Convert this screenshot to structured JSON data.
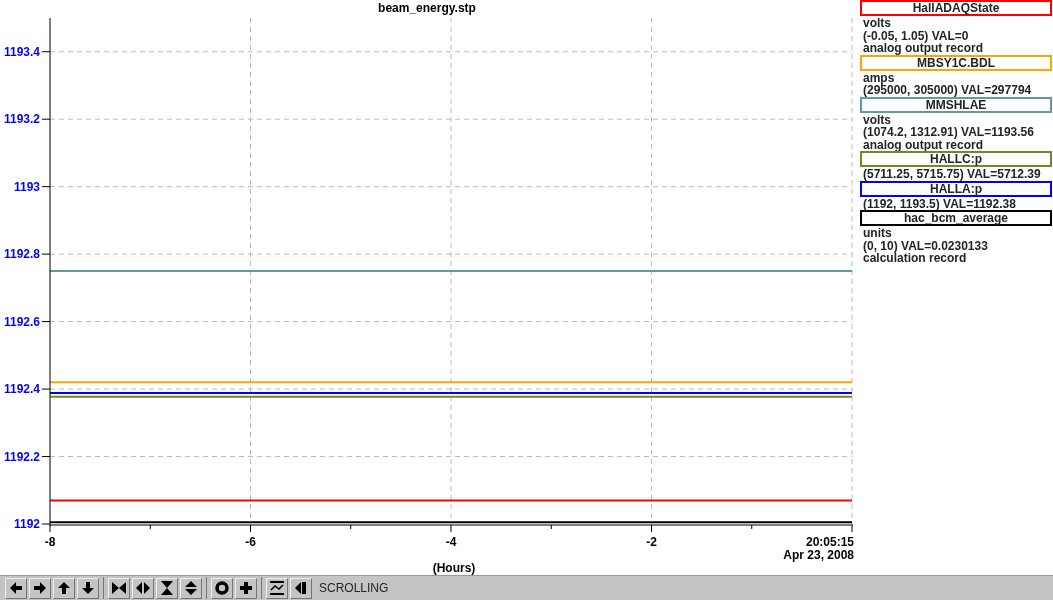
{
  "chart": {
    "chart_data": {
      "type": "line",
      "title": "beam_energy.stp",
      "xlabel": "(Hours)",
      "x": [
        -8,
        0
      ],
      "xlim": [
        -8,
        0
      ],
      "ylim": [
        1192,
        1193.5
      ],
      "xticks": [
        -8,
        -6,
        -4,
        -2
      ],
      "grid": true,
      "yticks": [
        1192,
        1192.2,
        1192.4,
        1192.6,
        1192.8,
        1193,
        1193.2,
        1193.4
      ],
      "series": [
        {
          "name": "HallADAQState",
          "color": "#ff0000",
          "values": [
            1192.07,
            1192.07
          ]
        },
        {
          "name": "MBSY1C.BDL",
          "color": "#ffa500",
          "values": [
            1192.42,
            1192.42
          ]
        },
        {
          "name": "MMSHLAE",
          "color": "#5f9ea0",
          "values": [
            1192.75,
            1192.75
          ]
        },
        {
          "name": "HALLC:p",
          "color": "#6b8e23",
          "values": [
            1192.377,
            1192.377
          ]
        },
        {
          "name": "HALLA:p",
          "color": "#0000ff",
          "values": [
            1192.388,
            1192.388
          ]
        },
        {
          "name": "hac_bcm_average",
          "color": "#000000",
          "values": [
            1192.005,
            1192.005
          ]
        }
      ]
    },
    "end_time": "20:05:15",
    "date": "Apr 23, 2008"
  },
  "legend": [
    {
      "lines": [
        "volts",
        "(-0.05, 1.05) VAL=0",
        "analog output record"
      ]
    },
    {
      "lines": [
        "amps",
        "(295000, 305000) VAL=297794"
      ]
    },
    {
      "lines": [
        "volts",
        "(1074.2, 1312.91)  VAL=1193.56",
        "analog output record"
      ]
    },
    {
      "lines": [
        "(5711.25, 5715.75) VAL=5712.39"
      ]
    },
    {
      "lines": [
        "(1192, 1193.5) VAL=1192.38"
      ]
    },
    {
      "lines": [
        "units",
        "(0, 10) VAL=0.0230133",
        "calculation record"
      ]
    }
  ],
  "toolbar": {
    "groups": [
      [
        {
          "kind": "left"
        },
        {
          "kind": "right"
        },
        {
          "kind": "up"
        },
        {
          "kind": "down"
        }
      ],
      [
        {
          "kind": "hshrink"
        },
        {
          "kind": "hexpand"
        },
        {
          "kind": "vshrink"
        },
        {
          "kind": "vexpand"
        }
      ],
      [
        {
          "kind": "ring"
        },
        {
          "kind": "plus"
        }
      ],
      [
        {
          "kind": "wave"
        },
        {
          "kind": "back"
        }
      ]
    ],
    "status": "SCROLLING"
  }
}
